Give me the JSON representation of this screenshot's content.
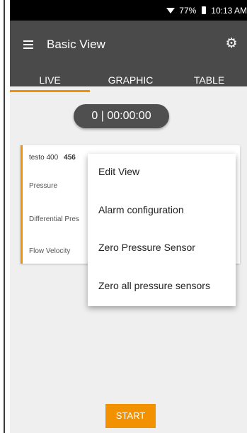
{
  "status_bar": {
    "battery": "77%",
    "time": "10:13 AM"
  },
  "app_bar": {
    "title": "Basic View",
    "menu_icon": "hamburger-menu-icon",
    "settings_icon": "gear-icon"
  },
  "tabs": [
    {
      "label": "LIVE",
      "active": true
    },
    {
      "label": "GRAPHIC",
      "active": false
    },
    {
      "label": "TABLE",
      "active": false
    }
  ],
  "timer": "0 | 00:00:00",
  "card": {
    "device": "testo 400",
    "serial": "456",
    "rows": [
      "Pressure",
      "Differential Pres",
      "Flow Velocity"
    ]
  },
  "context_menu": [
    "Edit View",
    "Alarm configuration",
    "Zero Pressure Sensor",
    "Zero all pressure sensors"
  ],
  "start_label": "START",
  "colors": {
    "accent": "#f39200",
    "app_bar": "#4a4a4a"
  }
}
